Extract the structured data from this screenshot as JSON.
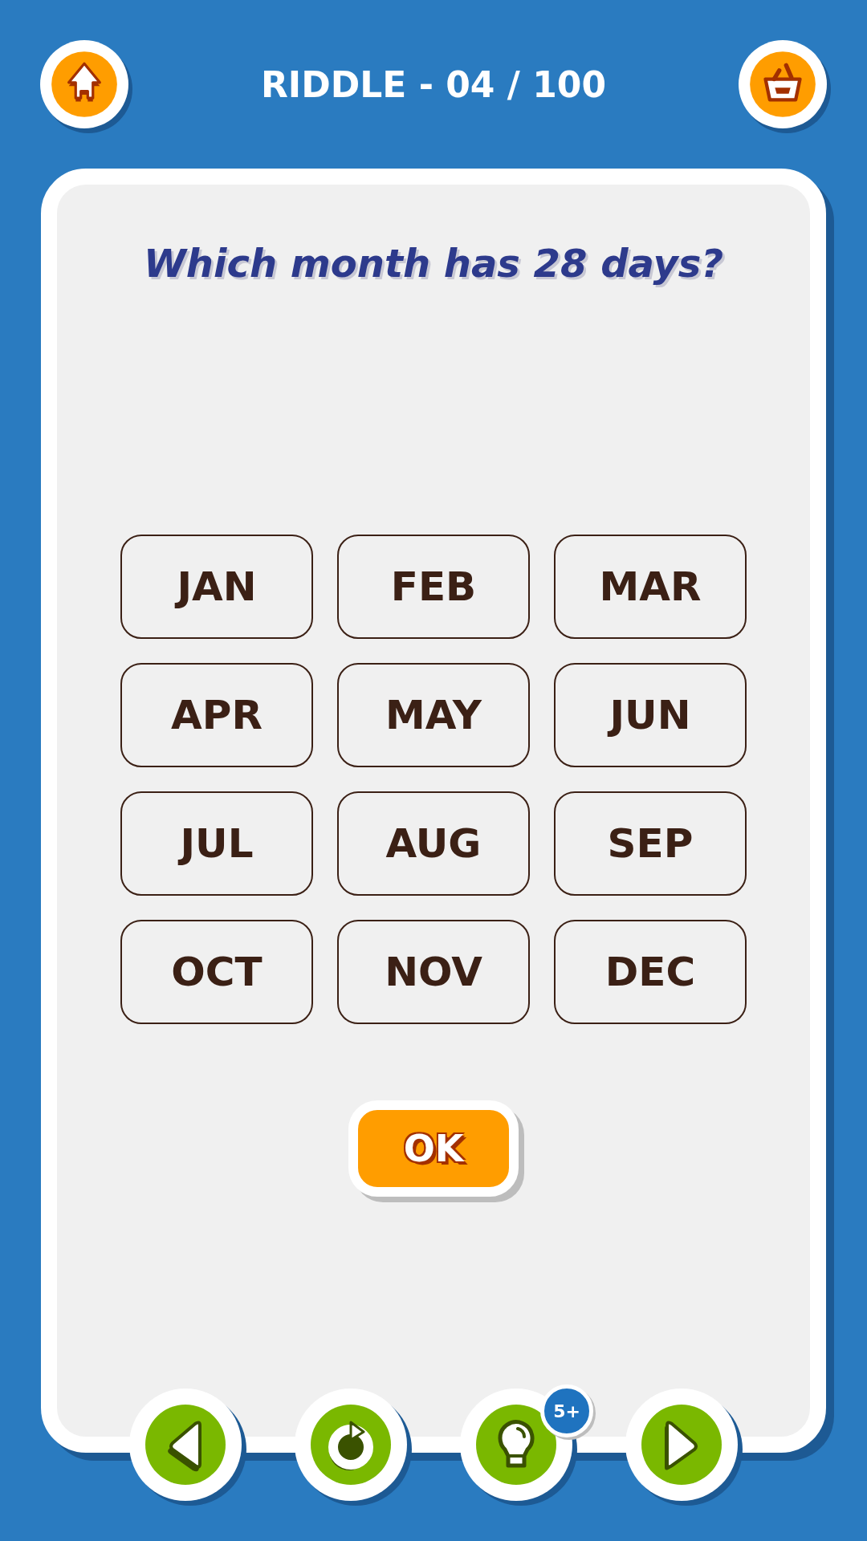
{
  "header": {
    "title": "RIDDLE - 04 / 100"
  },
  "question": "Which month has 28 days?",
  "options": [
    "JAN",
    "FEB",
    "MAR",
    "APR",
    "MAY",
    "JUN",
    "JUL",
    "AUG",
    "SEP",
    "OCT",
    "NOV",
    "DEC"
  ],
  "confirm_button": "OK",
  "toolbar": [
    {
      "kind": "back"
    },
    {
      "kind": "restart"
    },
    {
      "kind": "hint",
      "badge": "5+"
    },
    {
      "kind": "next"
    }
  ]
}
